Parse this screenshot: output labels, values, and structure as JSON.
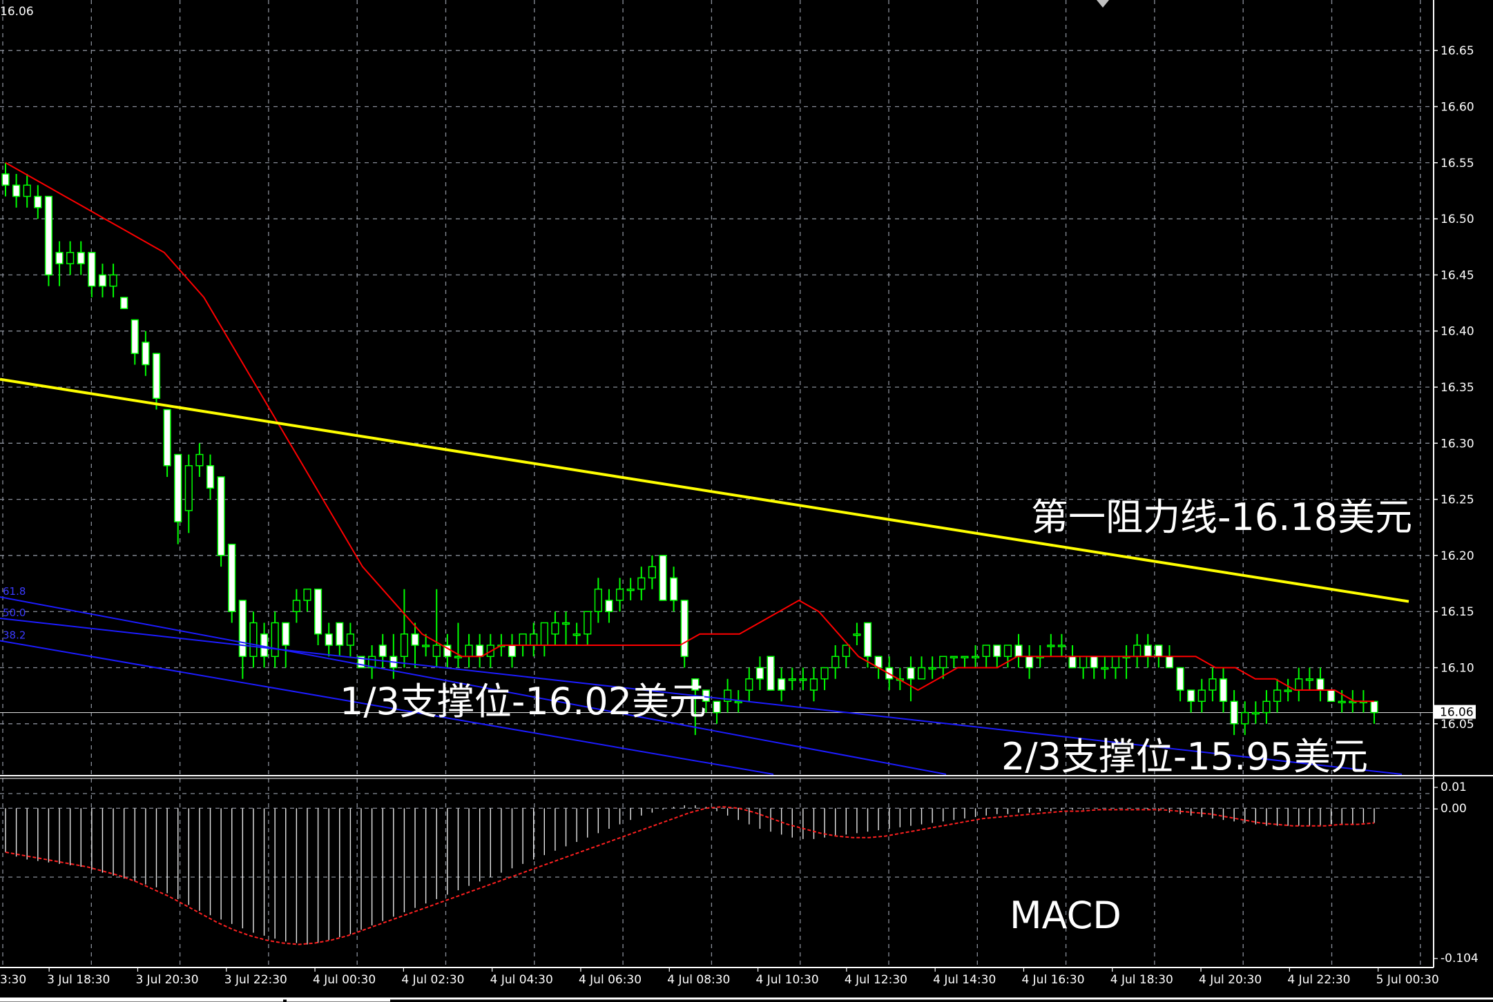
{
  "chart_data": [
    {
      "type": "candlestick",
      "symbol_price_top_left": "16.06",
      "price_labels": [
        "16.65",
        "16.60",
        "16.55",
        "16.50",
        "16.45",
        "16.40",
        "16.35",
        "16.30",
        "16.25",
        "16.20",
        "16.15",
        "16.10",
        "16.05"
      ],
      "current_price": "16.06",
      "ylim": [
        16.005,
        16.695
      ],
      "time_labels": [
        "3 Jul 18:30",
        "3 Jul 20:30",
        "3 Jul 22:30",
        "4 Jul 00:30",
        "4 Jul 02:30",
        "4 Jul 04:30",
        "4 Jul 06:30",
        "4 Jul 08:30",
        "4 Jul 10:30",
        "4 Jul 12:30",
        "4 Jul 14:30",
        "4 Jul 16:30",
        "4 Jul 18:30",
        "4 Jul 20:30",
        "4 Jul 22:30",
        "5 Jul 00:30"
      ],
      "first_time_label_partial": "3:30",
      "candles_ohlc": [
        [
          16.54,
          16.55,
          16.52,
          16.53
        ],
        [
          16.53,
          16.54,
          16.51,
          16.52
        ],
        [
          16.52,
          16.54,
          16.51,
          16.53
        ],
        [
          16.52,
          16.53,
          16.5,
          16.51
        ],
        [
          16.52,
          16.52,
          16.44,
          16.45
        ],
        [
          16.47,
          16.48,
          16.44,
          16.46
        ],
        [
          16.46,
          16.48,
          16.45,
          16.47
        ],
        [
          16.47,
          16.48,
          16.45,
          16.46
        ],
        [
          16.47,
          16.47,
          16.43,
          16.44
        ],
        [
          16.45,
          16.46,
          16.43,
          16.44
        ],
        [
          16.44,
          16.46,
          16.43,
          16.45
        ],
        [
          16.43,
          16.43,
          16.42,
          16.42
        ],
        [
          16.41,
          16.41,
          16.37,
          16.38
        ],
        [
          16.39,
          16.4,
          16.36,
          16.37
        ],
        [
          16.38,
          16.38,
          16.33,
          16.34
        ],
        [
          16.33,
          16.33,
          16.27,
          16.28
        ],
        [
          16.29,
          16.29,
          16.21,
          16.23
        ],
        [
          16.24,
          16.29,
          16.22,
          16.28
        ],
        [
          16.28,
          16.3,
          16.27,
          16.29
        ],
        [
          16.28,
          16.29,
          16.25,
          16.26
        ],
        [
          16.27,
          16.27,
          16.19,
          16.2
        ],
        [
          16.21,
          16.21,
          16.14,
          16.15
        ],
        [
          16.16,
          16.16,
          16.09,
          16.11
        ],
        [
          16.11,
          16.15,
          16.1,
          16.14
        ],
        [
          16.13,
          16.14,
          16.1,
          16.11
        ],
        [
          16.11,
          16.15,
          16.1,
          16.14
        ],
        [
          16.14,
          16.14,
          16.1,
          16.12
        ],
        [
          16.15,
          16.17,
          16.14,
          16.16
        ],
        [
          16.16,
          16.17,
          16.15,
          16.17
        ],
        [
          16.17,
          16.17,
          16.12,
          16.13
        ],
        [
          16.13,
          16.14,
          16.11,
          16.12
        ],
        [
          16.14,
          16.14,
          16.11,
          16.12
        ],
        [
          16.12,
          16.14,
          16.11,
          16.13
        ],
        [
          16.11,
          16.11,
          16.1,
          16.1
        ],
        [
          16.1,
          16.12,
          16.09,
          16.11
        ],
        [
          16.12,
          16.13,
          16.1,
          16.11
        ],
        [
          16.11,
          16.13,
          16.09,
          16.1
        ],
        [
          16.11,
          16.17,
          16.1,
          16.13
        ],
        [
          16.13,
          16.14,
          16.1,
          16.12
        ],
        [
          16.12,
          16.13,
          16.11,
          16.12
        ],
        [
          16.11,
          16.17,
          16.1,
          16.12
        ],
        [
          16.12,
          16.13,
          16.1,
          16.11
        ],
        [
          16.11,
          16.14,
          16.1,
          16.11
        ],
        [
          16.11,
          16.13,
          16.1,
          16.12
        ],
        [
          16.12,
          16.13,
          16.1,
          16.11
        ],
        [
          16.11,
          16.13,
          16.1,
          16.12
        ],
        [
          16.12,
          16.13,
          16.11,
          16.12
        ],
        [
          16.12,
          16.13,
          16.1,
          16.11
        ],
        [
          16.12,
          16.13,
          16.11,
          16.13
        ],
        [
          16.12,
          16.14,
          16.11,
          16.13
        ],
        [
          16.12,
          16.14,
          16.11,
          16.14
        ],
        [
          16.13,
          16.15,
          16.12,
          16.14
        ],
        [
          16.14,
          16.15,
          16.12,
          16.14
        ],
        [
          16.13,
          16.14,
          16.12,
          16.13
        ],
        [
          16.13,
          16.15,
          16.12,
          16.15
        ],
        [
          16.15,
          16.18,
          16.14,
          16.17
        ],
        [
          16.16,
          16.17,
          16.14,
          16.15
        ],
        [
          16.16,
          16.18,
          16.15,
          16.17
        ],
        [
          16.17,
          16.18,
          16.16,
          16.17
        ],
        [
          16.17,
          16.19,
          16.16,
          16.18
        ],
        [
          16.18,
          16.2,
          16.17,
          16.19
        ],
        [
          16.2,
          16.2,
          16.16,
          16.16
        ],
        [
          16.18,
          16.19,
          16.15,
          16.16
        ],
        [
          16.16,
          16.16,
          16.1,
          16.11
        ],
        [
          16.09,
          16.09,
          16.04,
          16.08
        ],
        [
          16.08,
          16.08,
          16.06,
          16.07
        ],
        [
          16.07,
          16.07,
          16.05,
          16.06
        ],
        [
          16.07,
          16.09,
          16.06,
          16.08
        ],
        [
          16.07,
          16.08,
          16.06,
          16.07
        ],
        [
          16.08,
          16.1,
          16.07,
          16.09
        ],
        [
          16.1,
          16.11,
          16.08,
          16.09
        ],
        [
          16.11,
          16.11,
          16.08,
          16.08
        ],
        [
          16.09,
          16.1,
          16.07,
          16.08
        ],
        [
          16.09,
          16.1,
          16.08,
          16.09
        ],
        [
          16.09,
          16.1,
          16.08,
          16.09
        ],
        [
          16.08,
          16.1,
          16.07,
          16.09
        ],
        [
          16.09,
          16.1,
          16.08,
          16.1
        ],
        [
          16.1,
          16.12,
          16.09,
          16.11
        ],
        [
          16.11,
          16.12,
          16.1,
          16.12
        ],
        [
          16.13,
          16.14,
          16.12,
          16.13
        ],
        [
          16.14,
          16.14,
          16.1,
          16.11
        ],
        [
          16.11,
          16.11,
          16.09,
          16.1
        ],
        [
          16.1,
          16.11,
          16.08,
          16.09
        ],
        [
          16.09,
          16.1,
          16.08,
          16.09
        ],
        [
          16.1,
          16.11,
          16.07,
          16.09
        ],
        [
          16.09,
          16.11,
          16.09,
          16.1
        ],
        [
          16.1,
          16.11,
          16.09,
          16.1
        ],
        [
          16.1,
          16.11,
          16.09,
          16.11
        ],
        [
          16.11,
          16.11,
          16.1,
          16.11
        ],
        [
          16.11,
          16.11,
          16.1,
          16.11
        ],
        [
          16.11,
          16.12,
          16.1,
          16.11
        ],
        [
          16.11,
          16.12,
          16.1,
          16.12
        ],
        [
          16.12,
          16.12,
          16.1,
          16.11
        ],
        [
          16.11,
          16.12,
          16.1,
          16.12
        ],
        [
          16.12,
          16.13,
          16.1,
          16.11
        ],
        [
          16.11,
          16.12,
          16.09,
          16.1
        ],
        [
          16.11,
          16.12,
          16.1,
          16.11
        ],
        [
          16.12,
          16.13,
          16.11,
          16.12
        ],
        [
          16.12,
          16.13,
          16.11,
          16.12
        ],
        [
          16.11,
          16.12,
          16.1,
          16.1
        ],
        [
          16.1,
          16.11,
          16.09,
          16.11
        ],
        [
          16.11,
          16.11,
          16.09,
          16.1
        ],
        [
          16.1,
          16.11,
          16.09,
          16.1
        ],
        [
          16.1,
          16.11,
          16.09,
          16.11
        ],
        [
          16.11,
          16.12,
          16.09,
          16.11
        ],
        [
          16.11,
          16.13,
          16.1,
          16.12
        ],
        [
          16.12,
          16.13,
          16.1,
          16.11
        ],
        [
          16.12,
          16.12,
          16.1,
          16.11
        ],
        [
          16.11,
          16.12,
          16.1,
          16.1
        ],
        [
          16.1,
          16.1,
          16.07,
          16.08
        ],
        [
          16.08,
          16.08,
          16.06,
          16.07
        ],
        [
          16.07,
          16.09,
          16.06,
          16.08
        ],
        [
          16.08,
          16.1,
          16.07,
          16.09
        ],
        [
          16.09,
          16.1,
          16.06,
          16.07
        ],
        [
          16.07,
          16.08,
          16.04,
          16.05
        ],
        [
          16.05,
          16.07,
          16.04,
          16.06
        ],
        [
          16.06,
          16.07,
          16.05,
          16.06
        ],
        [
          16.06,
          16.08,
          16.05,
          16.07
        ],
        [
          16.07,
          16.09,
          16.06,
          16.08
        ],
        [
          16.08,
          16.09,
          16.07,
          16.08
        ],
        [
          16.08,
          16.1,
          16.07,
          16.09
        ],
        [
          16.09,
          16.1,
          16.08,
          16.09
        ],
        [
          16.09,
          16.1,
          16.07,
          16.08
        ],
        [
          16.08,
          16.08,
          16.07,
          16.07
        ],
        [
          16.07,
          16.08,
          16.06,
          16.07
        ],
        [
          16.07,
          16.08,
          16.06,
          16.07
        ],
        [
          16.07,
          16.08,
          16.06,
          16.07
        ],
        [
          16.07,
          16.07,
          16.05,
          16.06
        ]
      ],
      "moving_average": [
        [
          16.55,
          16.54,
          16.53,
          16.52,
          16.51,
          16.5,
          16.49,
          16.48,
          16.47,
          16.45,
          16.43,
          16.4,
          16.37,
          16.34,
          16.31,
          16.28,
          16.25,
          16.22,
          16.19,
          16.17,
          16.15,
          16.13,
          16.12,
          16.11,
          16.11,
          16.12,
          16.12,
          16.12,
          16.12,
          16.12,
          16.12,
          16.12,
          16.12,
          16.12,
          16.12,
          16.13,
          16.13,
          16.13,
          16.14,
          16.15,
          16.16,
          16.15,
          16.13,
          16.11,
          16.1,
          16.09,
          16.08,
          16.09,
          16.1,
          16.1,
          16.1,
          16.11,
          16.11,
          16.11,
          16.11,
          16.11,
          16.11,
          16.11,
          16.11,
          16.11,
          16.11,
          16.1,
          16.1,
          16.09,
          16.09,
          16.08,
          16.08,
          16.08,
          16.07,
          16.07
        ]
      ],
      "horizontal_line": 16.06,
      "lines": [
        {
          "color": "#ffff00",
          "label": "第一阻力线-16.18美元"
        },
        {
          "color": "#2020ff"
        },
        {
          "color": "#2020ff"
        },
        {
          "color": "#2020ff"
        }
      ],
      "annotations": {
        "resistance": "第一阻力线-16.18美元",
        "support_1": "1/3支撑位-16.02美元",
        "support_2": "2/3支撑位-15.95美元",
        "indicator_name": "MACD"
      },
      "fibo_labels": [
        "61.8",
        "50.0",
        "38.2"
      ],
      "colors": {
        "background": "#000000",
        "grid": "#8a8f9a",
        "candle": "#00ff00",
        "bull_fill": "#000000",
        "bear_fill": "#ffffff",
        "ma": "#ff0000",
        "trend_resistance": "#ffff00",
        "channel": "#1c1cff",
        "text": "#ffffff",
        "price_tag_bg": "#ffffff",
        "price_tag_text": "#000000"
      }
    },
    {
      "type": "bar",
      "name": "MACD",
      "scale_labels": [
        "0.01",
        "0.00",
        "-0.104"
      ],
      "ylim": [
        -0.104,
        0.01
      ],
      "histogram": [
        -0.03,
        -0.033,
        -0.035,
        -0.036,
        -0.037,
        -0.038,
        -0.039,
        -0.04,
        -0.042,
        -0.044,
        -0.046,
        -0.048,
        -0.05,
        -0.052,
        -0.054,
        -0.058,
        -0.062,
        -0.066,
        -0.07,
        -0.073,
        -0.076,
        -0.079,
        -0.082,
        -0.085,
        -0.087,
        -0.089,
        -0.091,
        -0.092,
        -0.093,
        -0.092,
        -0.09,
        -0.088,
        -0.086,
        -0.083,
        -0.08,
        -0.077,
        -0.074,
        -0.071,
        -0.068,
        -0.065,
        -0.062,
        -0.059,
        -0.056,
        -0.053,
        -0.05,
        -0.047,
        -0.044,
        -0.041,
        -0.038,
        -0.035,
        -0.032,
        -0.029,
        -0.026,
        -0.023,
        -0.02,
        -0.017,
        -0.014,
        -0.011,
        -0.008,
        -0.005,
        -0.003,
        -0.001,
        0.001,
        0.002,
        0.002,
        0.001,
        -0.002,
        -0.005,
        -0.008,
        -0.011,
        -0.014,
        -0.016,
        -0.018,
        -0.02,
        -0.021,
        -0.021,
        -0.02,
        -0.019,
        -0.018,
        -0.017,
        -0.016,
        -0.015,
        -0.014,
        -0.013,
        -0.012,
        -0.011,
        -0.01,
        -0.009,
        -0.008,
        -0.007,
        -0.006,
        -0.005,
        -0.004,
        -0.004,
        -0.003,
        -0.003,
        -0.002,
        -0.002,
        -0.001,
        -0.001,
        -0.001,
        0.0,
        0.0,
        0.0,
        0.0,
        0.0,
        -0.001,
        -0.002,
        -0.003,
        -0.004,
        -0.005,
        -0.006,
        -0.007,
        -0.008,
        -0.009,
        -0.01,
        -0.011,
        -0.012,
        -0.012,
        -0.012,
        -0.012,
        -0.012,
        -0.012,
        -0.011,
        -0.011,
        -0.011,
        -0.01,
        -0.01
      ],
      "signal_line": [
        -0.03,
        -0.032,
        -0.034,
        -0.036,
        -0.038,
        -0.04,
        -0.043,
        -0.046,
        -0.05,
        -0.055,
        -0.06,
        -0.066,
        -0.072,
        -0.078,
        -0.083,
        -0.087,
        -0.09,
        -0.092,
        -0.093,
        -0.092,
        -0.09,
        -0.087,
        -0.083,
        -0.079,
        -0.075,
        -0.071,
        -0.067,
        -0.063,
        -0.059,
        -0.055,
        -0.051,
        -0.047,
        -0.043,
        -0.039,
        -0.035,
        -0.031,
        -0.027,
        -0.023,
        -0.019,
        -0.015,
        -0.011,
        -0.007,
        -0.003,
        0.0,
        0.001,
        0.0,
        -0.003,
        -0.007,
        -0.011,
        -0.014,
        -0.017,
        -0.019,
        -0.02,
        -0.02,
        -0.019,
        -0.017,
        -0.015,
        -0.013,
        -0.011,
        -0.009,
        -0.007,
        -0.006,
        -0.005,
        -0.004,
        -0.003,
        -0.002,
        -0.002,
        -0.001,
        -0.001,
        -0.001,
        -0.001,
        -0.001,
        -0.002,
        -0.003,
        -0.004,
        -0.006,
        -0.008,
        -0.01,
        -0.011,
        -0.012,
        -0.012,
        -0.012,
        -0.011,
        -0.011,
        -0.01
      ]
    }
  ]
}
